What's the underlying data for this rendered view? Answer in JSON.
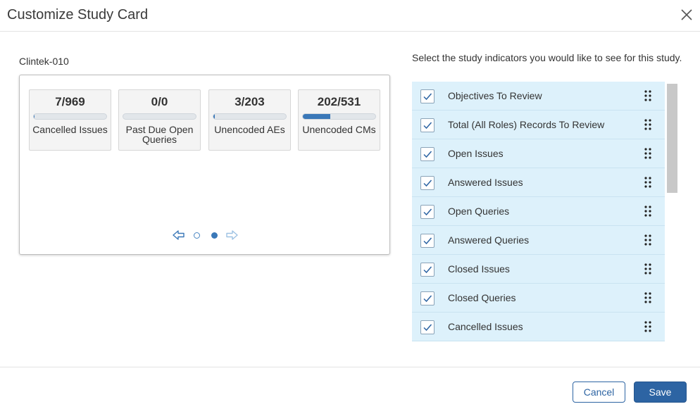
{
  "dialog": {
    "title": "Customize Study Card"
  },
  "preview": {
    "study_name": "Clintek-010",
    "tiles": [
      {
        "value": "7/969",
        "label": "Cancelled Issues",
        "progress": 0.007
      },
      {
        "value": "0/0",
        "label": "Past Due Open Queries",
        "progress": 0
      },
      {
        "value": "3/203",
        "label": "Unencoded AEs",
        "progress": 0.015
      },
      {
        "value": "202/531",
        "label": "Unencoded CMs",
        "progress": 0.38
      }
    ],
    "pager": {
      "pages": 2,
      "current": 2
    }
  },
  "indicators": {
    "instructions": "Select the study indicators you would like to see for this study.",
    "items": [
      {
        "label": "Objectives To Review",
        "checked": true
      },
      {
        "label": "Total (All Roles) Records To Review",
        "checked": true
      },
      {
        "label": "Open Issues",
        "checked": true
      },
      {
        "label": "Answered Issues",
        "checked": true
      },
      {
        "label": "Open Queries",
        "checked": true
      },
      {
        "label": "Answered Queries",
        "checked": true
      },
      {
        "label": "Closed Issues",
        "checked": true
      },
      {
        "label": "Closed Queries",
        "checked": true
      },
      {
        "label": "Cancelled Issues",
        "checked": true
      }
    ]
  },
  "footer": {
    "cancel_label": "Cancel",
    "save_label": "Save"
  },
  "colors": {
    "accent": "#2d64a3",
    "row_bg": "#ddf1fb",
    "progress_fill": "#3a78b8"
  },
  "icons": {
    "close": "close-icon",
    "prev": "arrow-left-icon",
    "next": "arrow-right-icon",
    "drag": "drag-handle-icon",
    "check": "checkmark-icon"
  }
}
